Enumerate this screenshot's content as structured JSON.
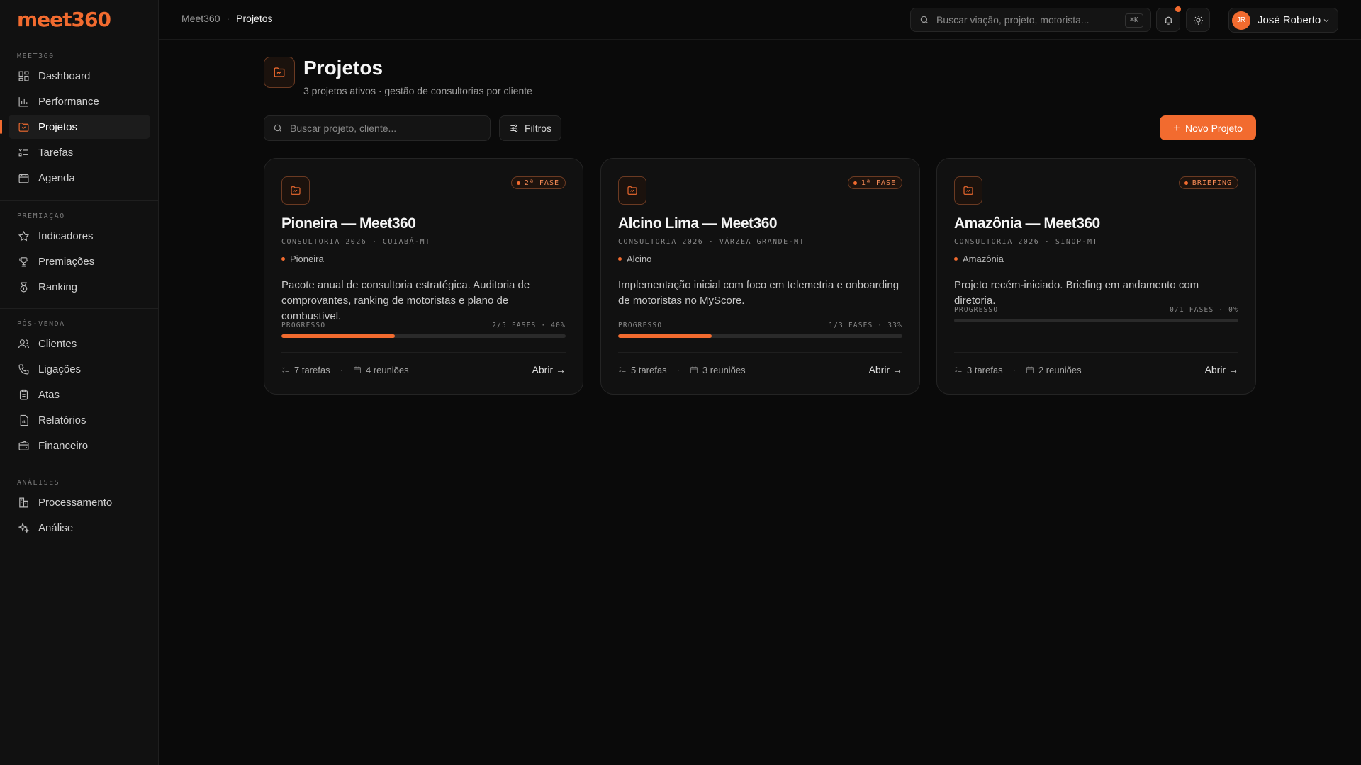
{
  "brand": {
    "logo_text": "meet360",
    "accent": "#f26b2f"
  },
  "sidebar": {
    "sections": [
      {
        "title": "MEET360",
        "items": [
          {
            "label": "Dashboard",
            "icon": "dashboard-icon"
          },
          {
            "label": "Performance",
            "icon": "bar-chart-icon"
          },
          {
            "label": "Projetos",
            "icon": "folder-icon",
            "active": true
          },
          {
            "label": "Tarefas",
            "icon": "list-check-icon"
          },
          {
            "label": "Agenda",
            "icon": "calendar-icon"
          }
        ]
      },
      {
        "title": "PREMIAÇÃO",
        "items": [
          {
            "label": "Indicadores",
            "icon": "star-icon"
          },
          {
            "label": "Premiações",
            "icon": "trophy-icon"
          },
          {
            "label": "Ranking",
            "icon": "medal-icon"
          }
        ]
      },
      {
        "title": "PÓS-VENDA",
        "items": [
          {
            "label": "Clientes",
            "icon": "users-icon"
          },
          {
            "label": "Ligações",
            "icon": "phone-icon"
          },
          {
            "label": "Atas",
            "icon": "clipboard-icon"
          },
          {
            "label": "Relatórios",
            "icon": "report-icon"
          },
          {
            "label": "Financeiro",
            "icon": "wallet-icon"
          }
        ]
      },
      {
        "title": "ANÁLISES",
        "items": [
          {
            "label": "Processamento",
            "icon": "process-icon"
          },
          {
            "label": "Análise",
            "icon": "sparkles-icon"
          }
        ]
      }
    ]
  },
  "topbar": {
    "breadcrumb": [
      "Meet360",
      "Projetos"
    ],
    "search_placeholder": "Buscar viação, projeto, motorista...",
    "search_shortcut": "⌘K",
    "user": {
      "initials": "JR",
      "name": "José Roberto"
    }
  },
  "page": {
    "title": "Projetos",
    "subtitle": "3 projetos ativos · gestão de consultorias por cliente",
    "search_placeholder": "Buscar projeto, cliente...",
    "filter_label": "Filtros",
    "new_button_label": "Novo Projeto"
  },
  "projects": [
    {
      "badge": "2ª FASE",
      "title": "Pioneira — Meet360",
      "meta": "CONSULTORIA 2026 · CUIABÁ-MT",
      "client": "Pioneira",
      "description": "Pacote anual de consultoria estratégica. Auditoria de comprovantes, ranking de motoristas e plano de combustível.",
      "progress_label": "PROGRESSO",
      "progress_text": "2/5 FASES · 40%",
      "progress": 0.4,
      "tasks": "7 tarefas",
      "meetings": "4 reuniões",
      "open_label": "Abrir →"
    },
    {
      "badge": "1ª FASE",
      "title": "Alcino Lima — Meet360",
      "meta": "CONSULTORIA 2026 · VÁRZEA GRANDE-MT",
      "client": "Alcino",
      "description": "Implementação inicial com foco em telemetria e onboarding de motoristas no MyScore.",
      "progress_label": "PROGRESSO",
      "progress_text": "1/3 FASES · 33%",
      "progress": 0.33,
      "tasks": "5 tarefas",
      "meetings": "3 reuniões",
      "open_label": "Abrir →"
    },
    {
      "badge": "BRIEFING",
      "title": "Amazônia — Meet360",
      "meta": "CONSULTORIA 2026 · SINOP-MT",
      "client": "Amazônia",
      "description": "Projeto recém-iniciado. Briefing em andamento com diretoria.",
      "progress_label": "PROGRESSO",
      "progress_text": "0/1 FASES · 0%",
      "progress": 0.0,
      "tasks": "3 tarefas",
      "meetings": "2 reuniões",
      "open_label": "Abrir →"
    }
  ]
}
